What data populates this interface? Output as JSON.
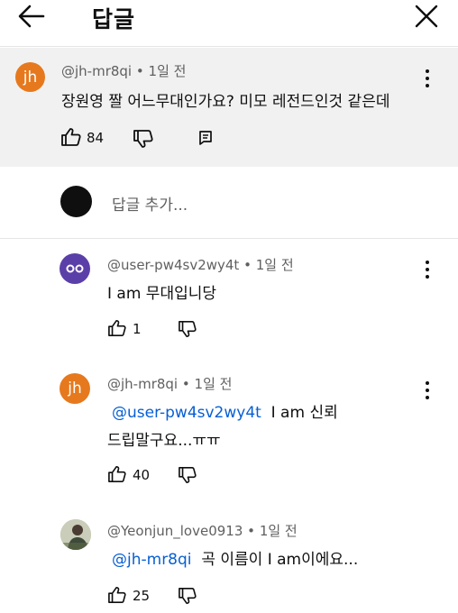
{
  "header": {
    "title": "답글"
  },
  "original": {
    "avatar_letter": "jh",
    "avatar_color": "#e6791d",
    "author": "@jh-mr8qi",
    "time": "1일 전",
    "text": "장원영 짤 어느무대인가요? 미모 레전드인것 같은데",
    "likes": "84"
  },
  "composer": {
    "placeholder": "답글 추가..."
  },
  "replies": [
    {
      "author": "@user-pw4sv2wy4t",
      "time": "1일 전",
      "avatar_color": "#5b3fa8",
      "text": "I am 무대입니당",
      "likes": "1"
    },
    {
      "author": "@jh-mr8qi",
      "time": "1일 전",
      "avatar_letter": "jh",
      "avatar_color": "#e6791d",
      "mention": "@user-pw4sv2wy4t",
      "text_line1": "I am 신뢰",
      "text_line2": "드립말구요...ㅠㅠ",
      "likes": "40"
    },
    {
      "author": "@Yeonjun_love0913",
      "time": "1일 전",
      "mention": "@jh-mr8qi",
      "text": "곡 이름이 I am이에요...",
      "likes": "25"
    }
  ],
  "separator": "•"
}
